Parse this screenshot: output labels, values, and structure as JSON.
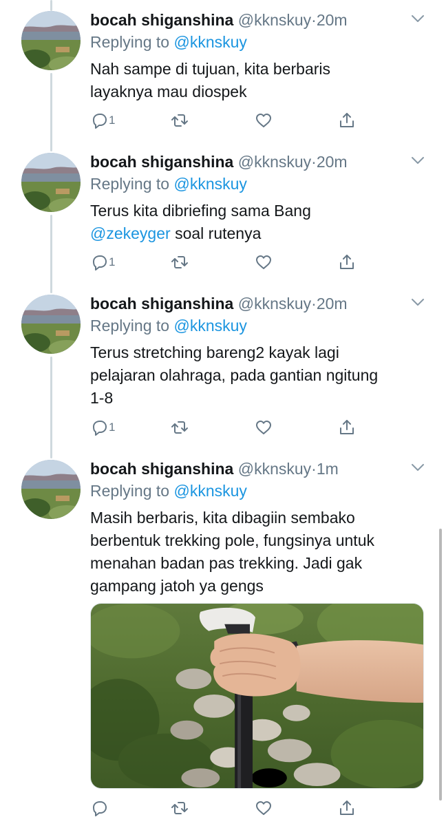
{
  "tweets": [
    {
      "name": "bocah shiganshina",
      "handle": "@kknskuy",
      "dot": "·",
      "time": "20m",
      "replying_prefix": "Replying to ",
      "replying_handle": "@kknskuy",
      "lines": [
        "Nah sampe di tujuan, kita berbaris",
        "layaknya mau diospek"
      ],
      "reply_count": "1"
    },
    {
      "name": "bocah shiganshina",
      "handle": "@kknskuy",
      "dot": "·",
      "time": "20m",
      "replying_prefix": "Replying to ",
      "replying_handle": "@kknskuy",
      "line1": "Terus kita dibriefing sama Bang",
      "line2_mention": "@zekeyger",
      "line2_rest": " soal rutenya",
      "reply_count": "1"
    },
    {
      "name": "bocah shiganshina",
      "handle": "@kknskuy",
      "dot": "·",
      "time": "20m",
      "replying_prefix": "Replying to ",
      "replying_handle": "@kknskuy",
      "lines": [
        "Terus stretching bareng2 kayak lagi",
        "pelajaran olahraga, pada gantian ngitung",
        "1-8"
      ],
      "reply_count": "1"
    },
    {
      "name": "bocah shiganshina",
      "handle": "@kknskuy",
      "dot": "·",
      "time": "1m",
      "replying_prefix": "Replying to ",
      "replying_handle": "@kknskuy",
      "lines": [
        "Masih berbaris, kita dibagiin sembako",
        "berbentuk trekking pole, fungsinya untuk",
        "menahan badan pas trekking. Jadi gak",
        "gampang jatoh ya gengs"
      ],
      "reply_count": ""
    }
  ],
  "icons": {
    "reply": "reply-icon",
    "retweet": "retweet-icon",
    "like": "heart-icon",
    "share": "share-icon",
    "more": "chevron-down-icon"
  },
  "colors": {
    "link": "#1b95e0",
    "secondary_text": "#657786",
    "primary_text": "#14171a",
    "thread_line": "#cfd9de"
  }
}
